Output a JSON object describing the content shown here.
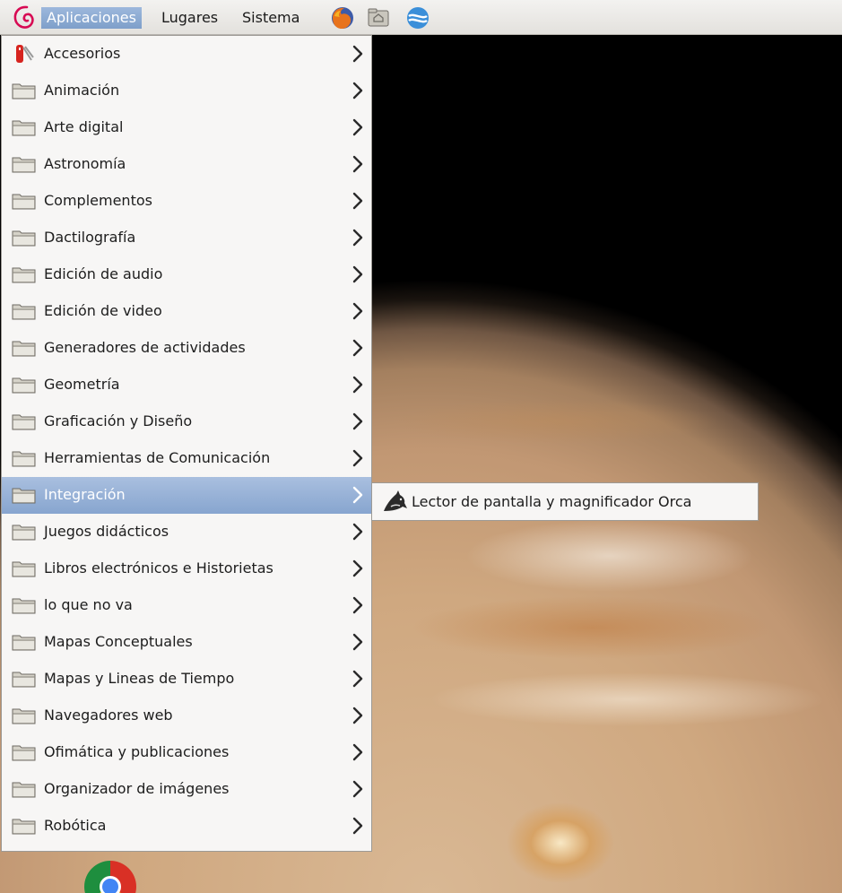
{
  "panel": {
    "menus": [
      {
        "label": "Aplicaciones"
      },
      {
        "label": "Lugares"
      },
      {
        "label": "Sistema"
      }
    ],
    "launchers": [
      "firefox-icon",
      "home-folder-icon",
      "web-browser-icon"
    ]
  },
  "applications_menu": {
    "items": [
      {
        "label": "Accesorios",
        "icon": "accessories-icon"
      },
      {
        "label": "Animación",
        "icon": "folder-icon"
      },
      {
        "label": "Arte digital",
        "icon": "folder-icon"
      },
      {
        "label": "Astronomía",
        "icon": "folder-icon"
      },
      {
        "label": "Complementos",
        "icon": "folder-icon"
      },
      {
        "label": "Dactilografía",
        "icon": "folder-icon"
      },
      {
        "label": "Edición de audio",
        "icon": "folder-icon"
      },
      {
        "label": "Edición de video",
        "icon": "folder-icon"
      },
      {
        "label": "Generadores de actividades",
        "icon": "folder-icon"
      },
      {
        "label": "Geometría",
        "icon": "folder-icon"
      },
      {
        "label": "Graficación y Diseño",
        "icon": "folder-icon"
      },
      {
        "label": "Herramientas de Comunicación",
        "icon": "folder-icon"
      },
      {
        "label": "Integración",
        "icon": "folder-icon",
        "highlighted": true
      },
      {
        "label": "Juegos didácticos",
        "icon": "folder-icon"
      },
      {
        "label": "Libros electrónicos e Historietas",
        "icon": "folder-icon"
      },
      {
        "label": "lo que no va",
        "icon": "folder-icon"
      },
      {
        "label": "Mapas Conceptuales",
        "icon": "folder-icon"
      },
      {
        "label": "Mapas y Lineas de Tiempo",
        "icon": "folder-icon"
      },
      {
        "label": "Navegadores web",
        "icon": "folder-icon"
      },
      {
        "label": "Ofimática y publicaciones",
        "icon": "folder-icon"
      },
      {
        "label": "Organizador de imágenes",
        "icon": "folder-icon"
      },
      {
        "label": "Robótica",
        "icon": "folder-icon"
      }
    ]
  },
  "submenu": {
    "items": [
      {
        "label": "Lector de pantalla y magnificador Orca",
        "icon": "orca-icon"
      }
    ]
  },
  "desktop": {
    "icons": [
      "chrome-icon"
    ]
  },
  "colors": {
    "highlight": "#87a5cf",
    "menu_bg": "#f7f6f5",
    "panel_bg": "#e3e1dd"
  }
}
